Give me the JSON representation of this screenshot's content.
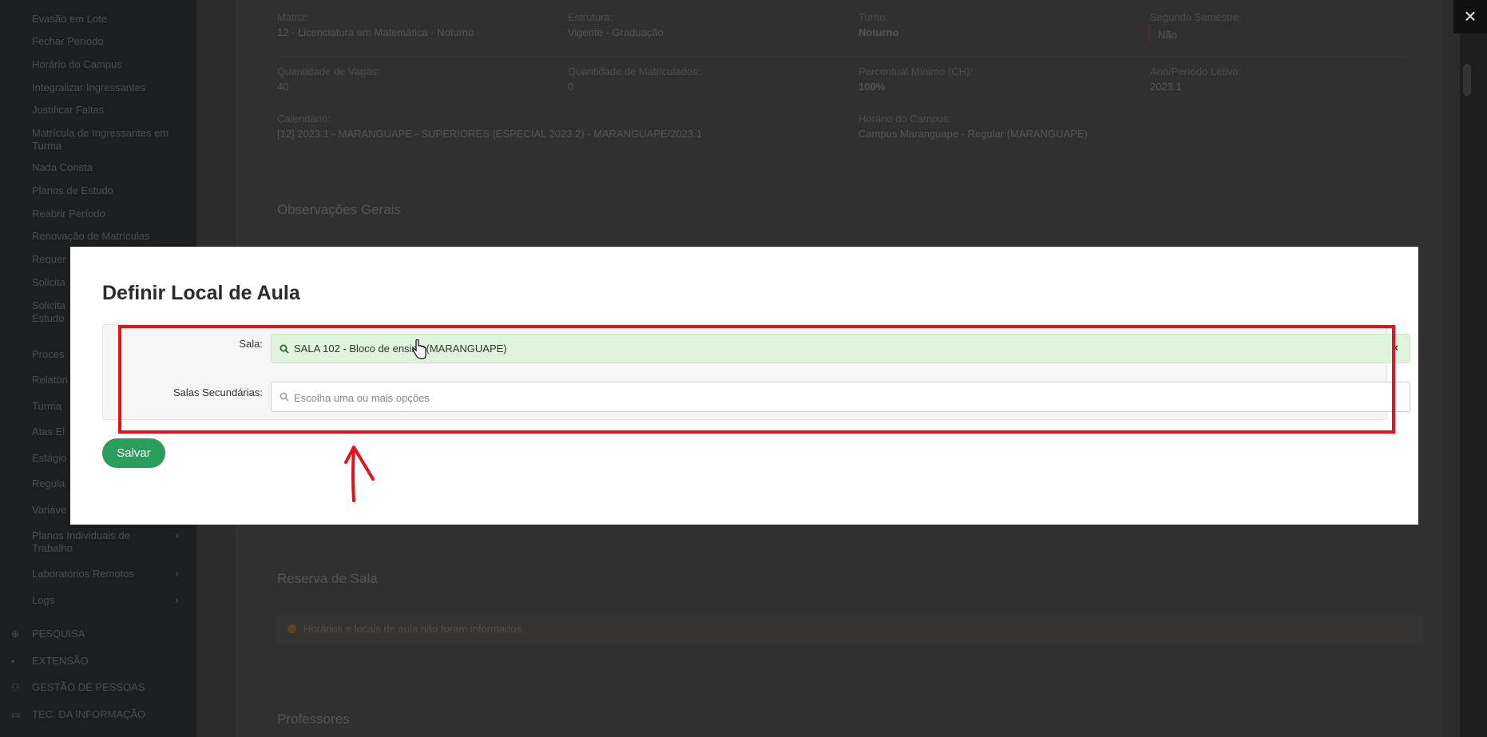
{
  "sidebar": {
    "items": [
      {
        "label": "Evasão em Lote"
      },
      {
        "label": "Fechar Período"
      },
      {
        "label": "Horário do Campus"
      },
      {
        "label": "Integralizar Ingressantes"
      },
      {
        "label": "Justificar Faltas"
      },
      {
        "label": "Matrícula de Ingressantes em Turma"
      },
      {
        "label": "Nada Consta"
      },
      {
        "label": "Planos de Estudo"
      },
      {
        "label": "Reabrir Período"
      },
      {
        "label": "Renovação de Matrículas"
      },
      {
        "label": "Requer"
      },
      {
        "label": "Solicita"
      },
      {
        "label": "Solicita Estudo"
      },
      {
        "label": "Proces"
      },
      {
        "label": "Relatóri"
      },
      {
        "label": "Turma"
      },
      {
        "label": "Atas El"
      },
      {
        "label": "Estágio"
      },
      {
        "label": "Regula"
      },
      {
        "label": "Variáve"
      },
      {
        "label": "Planos Individuais de Trabalho",
        "chevron": "›"
      },
      {
        "label": "Laboratórios Remotos",
        "chevron": "›"
      },
      {
        "label": "Logs",
        "chevron": "›"
      }
    ],
    "sections": [
      {
        "label": "PESQUISA",
        "icon": "globe-icon",
        "glyph": "⊕"
      },
      {
        "label": "EXTENSÃO",
        "icon": "briefcase-icon",
        "glyph": "▪"
      },
      {
        "label": "GESTÃO DE PESSOAS",
        "icon": "users-icon",
        "glyph": "⚇"
      },
      {
        "label": "TEC. DA INFORMAÇÃO",
        "icon": "laptop-icon",
        "glyph": "▭"
      }
    ]
  },
  "details": {
    "matriz_label": "Matriz:",
    "matriz_value": "12 - Licenciatura em Matemática - Noturno",
    "estrutura_label": "Estrutura:",
    "estrutura_value": "Vigente - Graduação",
    "turno_label": "Turno:",
    "turno_value": "Noturno",
    "segundo_label": "Segundo Semestre:",
    "segundo_value": "Não",
    "vagas_label": "Quantidade de Vagas:",
    "vagas_value": "40",
    "matriculados_label": "Quantidade de Matriculados:",
    "matriculados_value": "0",
    "percentual_label": "Percentual Mínimo (CH):",
    "percentual_value": "100%",
    "ano_label": "Ano/Período Letivo:",
    "ano_value": "2023.1",
    "calendario_label": "Calendário:",
    "calendario_value": "[12] 2023.1 - MARANGUAPE - SUPERIORES (ESPECIAL 2023.2) - MARANGUAPE/2023.1",
    "horario_label": "Horário do Campus:",
    "horario_value": "Campus Maranguape - Regular (MARANGUAPE)"
  },
  "sections": {
    "observacoes": "Observações Gerais",
    "reserva": "Reserva de Sala",
    "reserva_notice": "Horários e locais de aula não foram informados.",
    "professores": "Professores"
  },
  "close_label": "×",
  "modal": {
    "title": "Definir Local de Aula",
    "sala_label": "Sala:",
    "sala_value": "SALA 102 - Bloco de ensino (MARANGUAPE)",
    "sala_clear": "×",
    "salas_sec_label": "Salas Secundárias:",
    "salas_sec_placeholder": "Escolha uma ou mais opções",
    "save_label": "Salvar"
  },
  "colors": {
    "save_button": "#2a9d5c",
    "selected_bg": "#dff3dd",
    "annotation": "#e8101a"
  }
}
